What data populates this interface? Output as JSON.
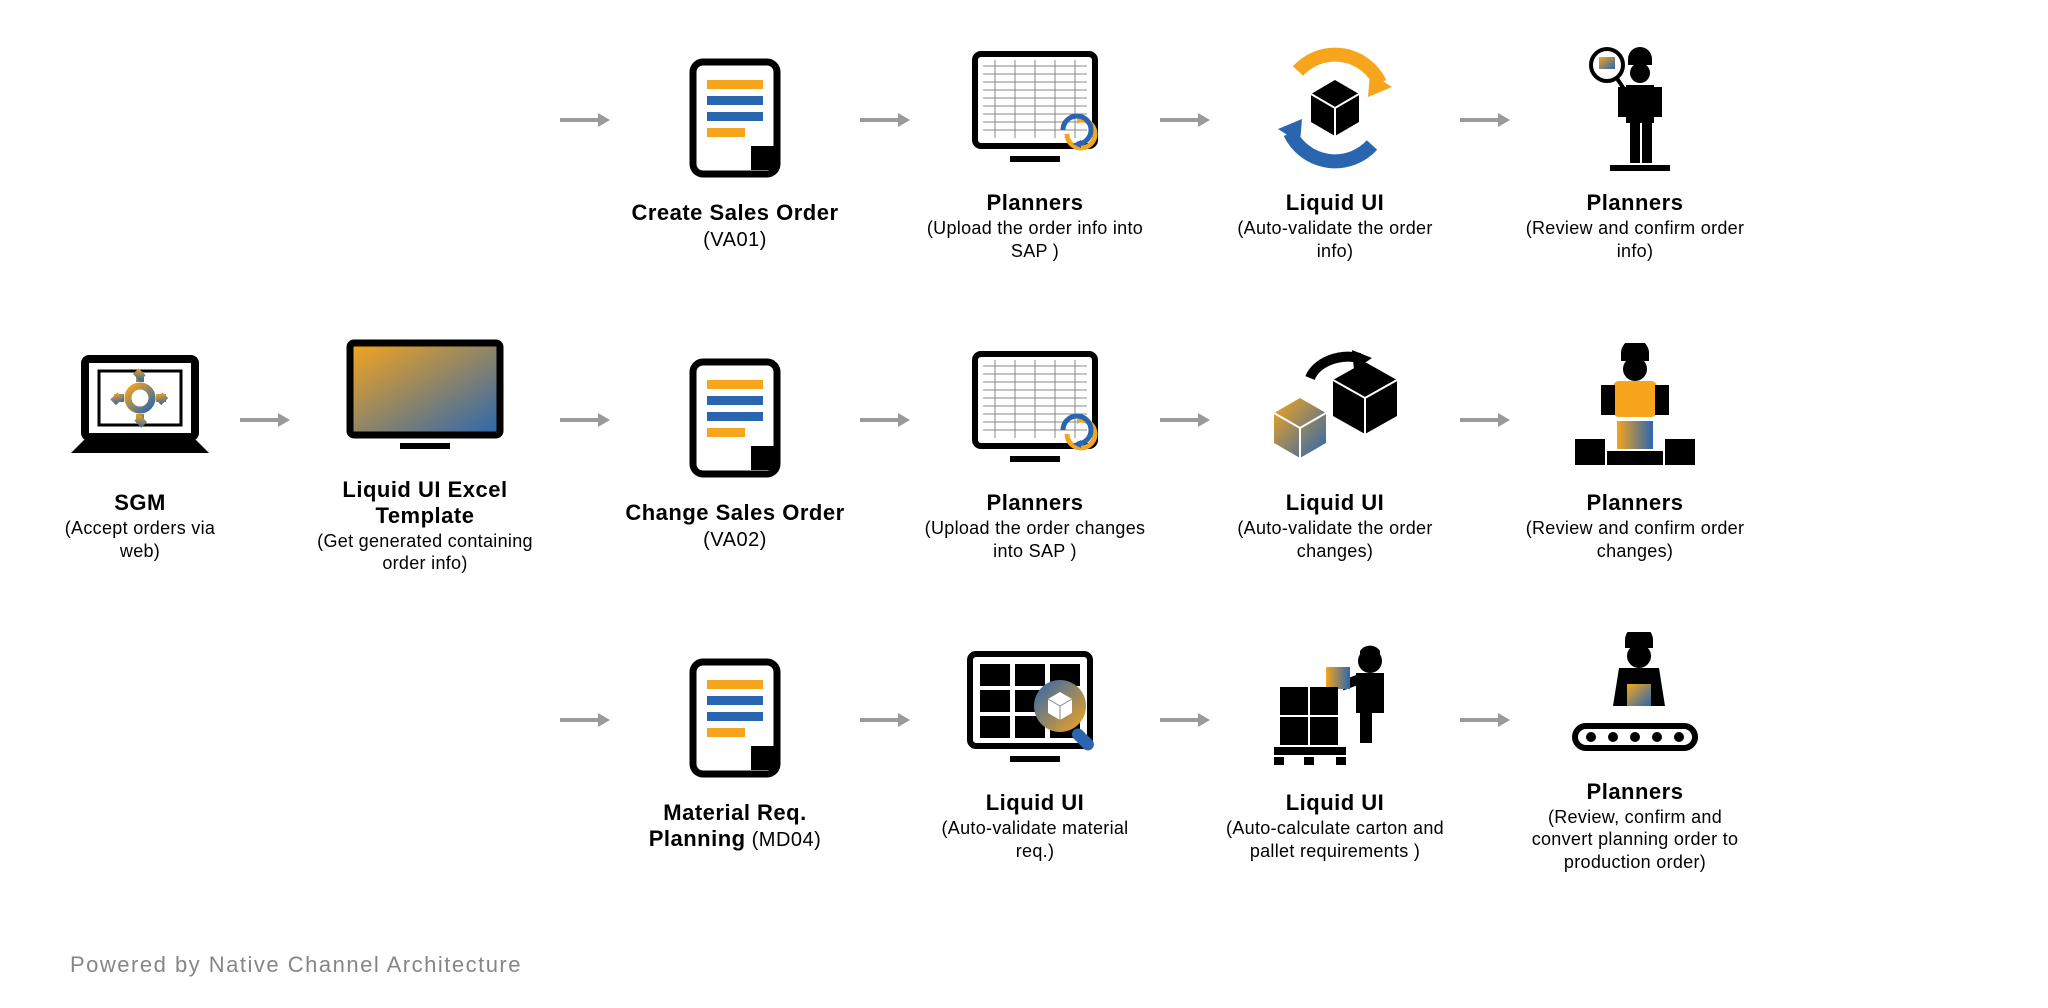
{
  "footer": "Powered by Native Channel Architecture",
  "colors": {
    "orange": "#f7a51c",
    "blue": "#2a66b0",
    "grey": "#9a9a9a"
  },
  "start": {
    "sgm": {
      "title": "SGM",
      "subtitle": "(Accept orders via web)"
    },
    "excel": {
      "title": "Liquid UI Excel Template",
      "subtitle": "(Get generated containing order info)"
    }
  },
  "rows": [
    {
      "nodes": [
        {
          "key": "createSales",
          "title": "Create Sales Order",
          "code": " (VA01)",
          "subtitle": ""
        },
        {
          "key": "plannersUpload1",
          "title": "Planners",
          "subtitle": "(Upload the order info into SAP )"
        },
        {
          "key": "liquidValidate1",
          "title": "Liquid UI",
          "subtitle": "(Auto-validate the order info)"
        },
        {
          "key": "plannersReview1",
          "title": "Planners",
          "subtitle": "(Review and confirm order info)"
        }
      ]
    },
    {
      "nodes": [
        {
          "key": "changeSales",
          "title": "Change Sales Order",
          "code": " (VA02)",
          "subtitle": ""
        },
        {
          "key": "plannersUpload2",
          "title": "Planners",
          "subtitle": "(Upload the order changes into SAP )"
        },
        {
          "key": "liquidValidate2",
          "title": "Liquid UI",
          "subtitle": "(Auto-validate the order changes)"
        },
        {
          "key": "plannersReview2",
          "title": "Planners",
          "subtitle": "(Review and confirm order changes)"
        }
      ]
    },
    {
      "nodes": [
        {
          "key": "mrp",
          "title": "Material Req. Planning",
          "code": " (MD04)",
          "subtitle": ""
        },
        {
          "key": "liquidMrp",
          "title": "Liquid UI",
          "subtitle": "(Auto-validate material req.)"
        },
        {
          "key": "liquidCarton",
          "title": "Liquid UI",
          "subtitle": "(Auto-calculate carton and pallet requirements )"
        },
        {
          "key": "plannersProd",
          "title": "Planners",
          "subtitle": "(Review, confirm and convert planning order to production order)"
        }
      ]
    }
  ]
}
